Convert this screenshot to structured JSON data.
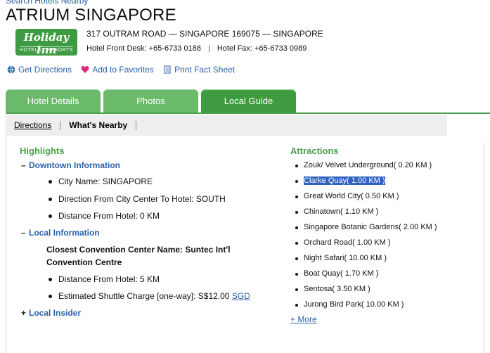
{
  "top_link": "Search Hotels Nearby",
  "hotel": {
    "name": "ATRIUM SINGAPORE",
    "address": "317 OUTRAM ROAD  —  SINGAPORE 169075  —  SINGAPORE",
    "front_desk": "Hotel Front Desk: +65-6733 0188",
    "fax": "Hotel Fax: +65-6733 0989",
    "phone_sep": "|"
  },
  "logo": {
    "line1": "Holiday Inn",
    "line2": "HOTELS · RESORTS"
  },
  "actions": {
    "directions": "Get Directions",
    "favorites": "Add to Favorites",
    "print": "Print Fact Sheet"
  },
  "tabs": [
    {
      "label": "Hotel Details"
    },
    {
      "label": "Photos"
    },
    {
      "label": "Local Guide"
    }
  ],
  "subnav": [
    {
      "label": "Directions"
    },
    {
      "label": "What's Nearby"
    }
  ],
  "highlights": {
    "heading": "Highlights",
    "downtown": {
      "toggle": "–",
      "label": "Downtown Information",
      "items": [
        "City Name: SINGAPORE",
        "Direction From City Center To Hotel: SOUTH",
        "Distance From Hotel: 0 KM"
      ]
    },
    "local": {
      "toggle": "–",
      "label": "Local Information",
      "convention_line1": "Closest Convention Center Name: Suntec Int'l",
      "convention_line2": "Convention Centre",
      "distance": "Distance From Hotel: 5 KM",
      "shuttle": "Estimated Shuttle Charge [one-way]: S$12.00",
      "currency": "SGD"
    },
    "insider": {
      "toggle": "+",
      "label": "Local Insider"
    }
  },
  "attractions": {
    "heading": "Attractions",
    "items": [
      "Zouk/ Velvet Underground( 0.20 KM )",
      "Clarke Quay( 1.00 KM )",
      "Great World City( 0.50 KM )",
      "Chinatown( 1.10 KM )",
      "Singapore Botanic Gardens( 2.00 KM )",
      "Orchard Road( 1.00 KM )",
      "Night Safari( 10.00 KM )",
      "Boat Quay( 1.70 KM )",
      "Sentosa( 3.50 KM )",
      "Jurong Bird Park( 10.00 KM )"
    ],
    "selected_index": 1,
    "more": "+ More"
  }
}
